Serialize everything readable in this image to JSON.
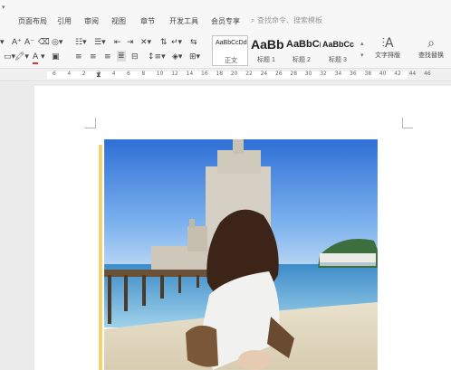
{
  "menu": {
    "items": [
      "页面布局",
      "引用",
      "审阅",
      "视图",
      "章节",
      "开发工具",
      "会员专享"
    ],
    "search_placeholder": "查找命令、搜索模板"
  },
  "styles": [
    {
      "preview": "AaBbCcDd",
      "label": "正文"
    },
    {
      "preview": "AaBb",
      "label": "标题 1"
    },
    {
      "preview": "AaBbC(",
      "label": "标题 2"
    },
    {
      "preview": "AaBbCc",
      "label": "标题 3"
    }
  ],
  "buttons": {
    "text_layout": "文字排版",
    "find_replace": "查找替换"
  },
  "ruler": {
    "ticks": [
      "6",
      "4",
      "2",
      "2",
      "4",
      "6",
      "8",
      "10",
      "12",
      "14",
      "16",
      "18",
      "20",
      "22",
      "24",
      "26",
      "28",
      "30",
      "32",
      "34",
      "36",
      "38",
      "40",
      "42",
      "44",
      "46"
    ]
  }
}
